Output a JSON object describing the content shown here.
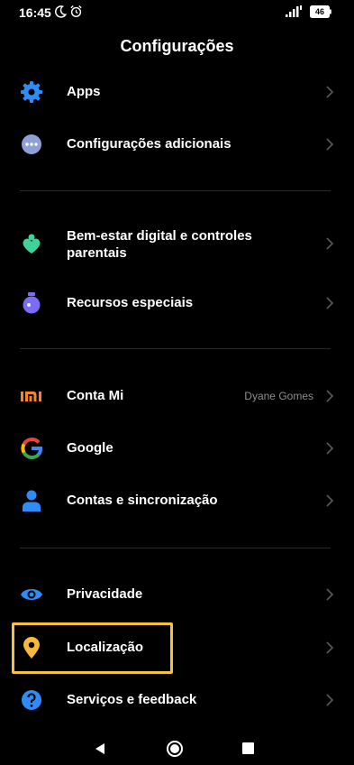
{
  "status": {
    "time": "16:45",
    "battery": "46",
    "moon_icon": "moon-icon",
    "alarm_icon": "alarm-icon"
  },
  "header": {
    "title": "Configurações"
  },
  "items": [
    {
      "id": "apps",
      "label": "Apps",
      "icon": "gear-icon"
    },
    {
      "id": "additional",
      "label": "Configurações adicionais",
      "icon": "more-dots-icon"
    },
    {
      "id": "wellbeing",
      "label_line1": "Bem-estar digital e controles",
      "label_line2": "parentais",
      "icon": "wellbeing-icon"
    },
    {
      "id": "special",
      "label": "Recursos especiais",
      "icon": "flask-icon"
    },
    {
      "id": "mi-account",
      "label": "Conta Mi",
      "value": "Dyane Gomes",
      "icon": "mi-logo-icon"
    },
    {
      "id": "google",
      "label": "Google",
      "icon": "google-icon"
    },
    {
      "id": "accounts",
      "label": "Contas e sincronização",
      "icon": "person-icon"
    },
    {
      "id": "privacy",
      "label": "Privacidade",
      "icon": "eye-icon"
    },
    {
      "id": "location",
      "label": "Localização",
      "icon": "location-pin-icon"
    },
    {
      "id": "feedback",
      "label": "Serviços e feedback",
      "icon": "help-icon"
    }
  ],
  "colors": {
    "background": "#000000",
    "text": "#ffffff",
    "secondary_text": "#8e8e8e",
    "highlight": "#f6c23c",
    "blue": "#2f8cf6",
    "green": "#3fd39a",
    "purple": "#7b6cf6",
    "orange": "#f5852b",
    "yellow": "#f6b93b"
  }
}
